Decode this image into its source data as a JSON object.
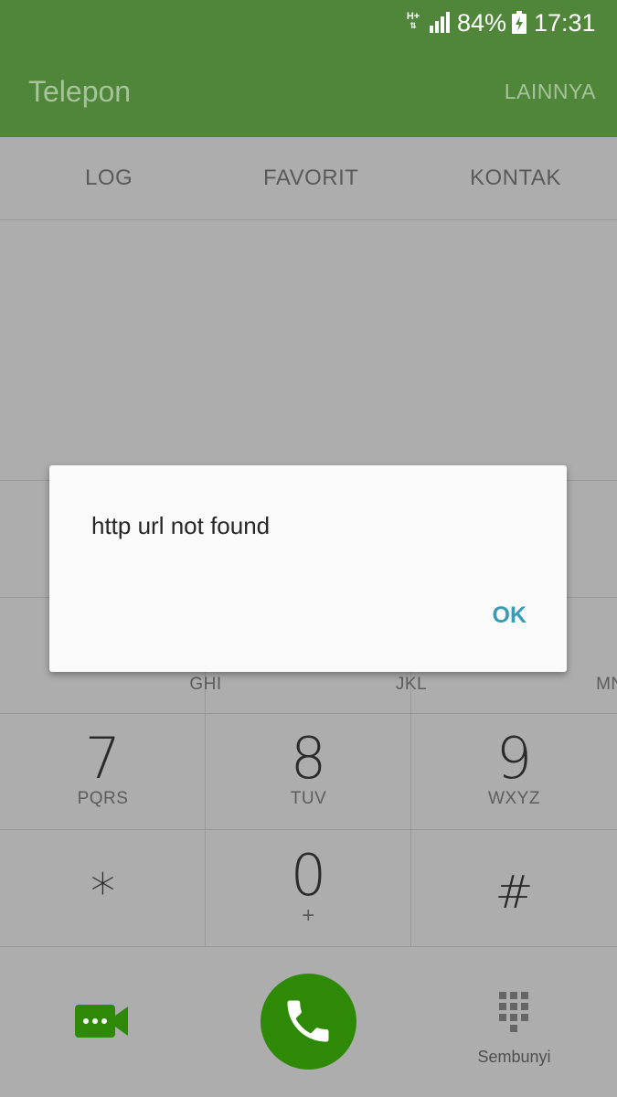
{
  "status_bar": {
    "network": "H+",
    "battery_percent": "84%",
    "time": "17:31"
  },
  "app_bar": {
    "title": "Telepon",
    "more_label": "LAINNYA"
  },
  "tabs": [
    {
      "label": "LOG"
    },
    {
      "label": "FAVORIT"
    },
    {
      "label": "KONTAK"
    }
  ],
  "dialpad": {
    "partial_row": [
      "GHI",
      "JKL",
      "MNO"
    ],
    "keys": [
      {
        "num": "7",
        "letters": "PQRS"
      },
      {
        "num": "8",
        "letters": "TUV"
      },
      {
        "num": "9",
        "letters": "WXYZ"
      },
      {
        "num": "*",
        "letters": ""
      },
      {
        "num": "0",
        "letters": "+"
      },
      {
        "num": "#",
        "letters": ""
      }
    ]
  },
  "actions": {
    "hide_label": "Sembunyi"
  },
  "dialog": {
    "message": "http url not found",
    "ok_label": "OK"
  },
  "colors": {
    "header": "#4f8639",
    "call_button": "#2e8a06",
    "dialog_accent": "#3d9ab3"
  }
}
